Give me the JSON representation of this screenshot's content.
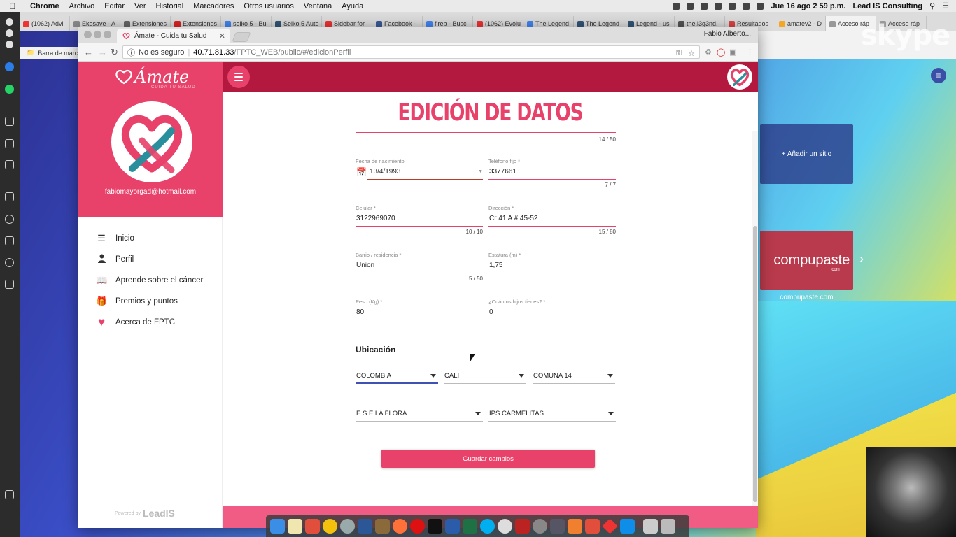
{
  "menubar": {
    "app": "Chrome",
    "items": [
      "Archivo",
      "Editar",
      "Ver",
      "Historial",
      "Marcadores",
      "Otros usuarios",
      "Ventana",
      "Ayuda"
    ],
    "clock": "Jue 16 ago  2 59 p.m.",
    "account": "Lead IS Consulting"
  },
  "background_browser": {
    "tabs": [
      "(1062) Advi",
      "Ekosave - A",
      "Extensiones",
      "Extensiones",
      "seiko 5 - Bu",
      "Seiko 5 Auto",
      "Sidebar for",
      "Facebook -",
      "fireb - Busc",
      "(1062) Evolu",
      "The Legend",
      "The Legend",
      "Legend - us",
      "the.l3g3nd.",
      "Resultados",
      "amatev2 - D",
      "Acceso ráp",
      "Acceso ráp"
    ],
    "bookmarks_label": "Barra de marcad",
    "skype": "skype",
    "add_site": "+ Añadir un sitio",
    "tile_name": "compupaste",
    "tile_sub": "com",
    "tile_label": "compupaste.com"
  },
  "browser": {
    "tab_title": "Ámate - Cuida tu Salud",
    "user": "Fabio Alberto...",
    "security": "No es seguro",
    "host": "40.71.81.33",
    "path": "/FPTC_WEB/public/#/edicionPerfil"
  },
  "sidebar": {
    "brand": "Ámate",
    "tagline": "CUIDA TU SALUD",
    "email": "fabiomayorgad@hotmail.com",
    "items": [
      {
        "label": "Inicio",
        "icon": "list-icon"
      },
      {
        "label": "Perfil",
        "icon": "person-icon"
      },
      {
        "label": "Aprende sobre el cáncer",
        "icon": "book-icon"
      },
      {
        "label": "Premios y puntos",
        "icon": "gift-icon"
      },
      {
        "label": "Acerca de FPTC",
        "icon": "heart-icon"
      }
    ],
    "powered_by": "Powered by",
    "powered_brand": "LeadIS"
  },
  "page": {
    "title": "EDICIÓN DE DATOS",
    "top_counter": "14 / 50",
    "fields": {
      "birth": {
        "label": "Fecha de nacimiento",
        "value": "13/4/1993"
      },
      "phone": {
        "label": "Teléfono fijo *",
        "value": "3377661",
        "counter": "7 / 7"
      },
      "cell": {
        "label": "Celular *",
        "value": "3122969070",
        "counter": "10 / 10"
      },
      "address": {
        "label": "Dirección *",
        "value": "Cr 41 A # 45-52",
        "counter": "15 / 80"
      },
      "neighborhood": {
        "label": "Barrio / residencia *",
        "value": "Union",
        "counter": "5 / 50"
      },
      "height": {
        "label": "Estatura (m) *",
        "value": "1,75"
      },
      "weight": {
        "label": "Peso (Kg) *",
        "value": "80"
      },
      "children": {
        "label": "¿Cuántos hijos tienes? *",
        "value": "0"
      }
    },
    "location_title": "Ubicación",
    "selects": {
      "country": "COLOMBIA",
      "city": "CALI",
      "district": "COMUNA 14",
      "ese": "E.S.E LA FLORA",
      "ips": "IPS CARMELITAS"
    },
    "save": "Guardar cambios"
  },
  "colors": {
    "primary": "#e8416a",
    "topbar": "#b3183e",
    "focus": "#3f51b5"
  }
}
